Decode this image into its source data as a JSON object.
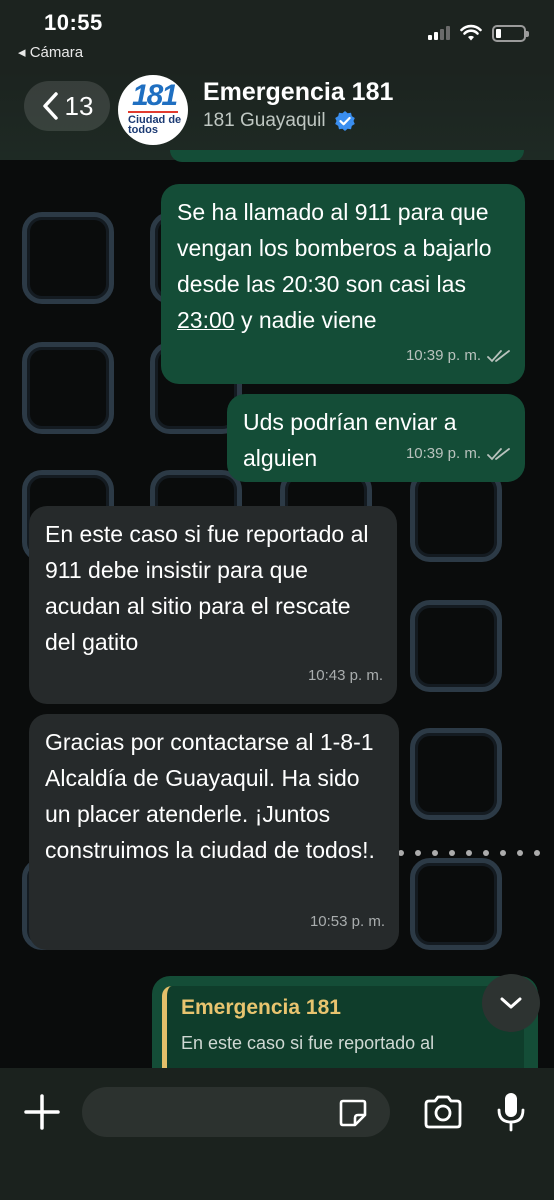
{
  "status_bar": {
    "time": "10:55",
    "back_to_app": "◂ Cámara"
  },
  "header": {
    "back_count": "13",
    "contact_name": "Emergencia 181",
    "contact_subtitle": "181 Guayaquil",
    "avatar_logo_number": "181",
    "avatar_logo_text": "Ciudad de todos"
  },
  "messages": [
    {
      "direction": "out",
      "text_before": "Se ha llamado al 911 para que vengan los bomberos a bajarlo desde las 20:30 son casi las ",
      "text_underlined": "23:00",
      "text_after": " y nadie viene",
      "time": "10:39 p. m."
    },
    {
      "direction": "out",
      "text": "Uds podrían enviar a alguien",
      "time": "10:39 p. m."
    },
    {
      "direction": "in",
      "text": "En este caso si fue reportado al 911 debe insistir para que acudan al sitio para el rescate del gatito",
      "time": "10:43 p. m."
    },
    {
      "direction": "in",
      "text": "Gracias por contactarse al 1-8-1 Alcaldía de Guayaquil. Ha sido un placer atenderle. ¡Juntos construimos la ciudad de todos!.",
      "time": "10:53 p. m."
    }
  ],
  "quoted_reply": {
    "author": "Emergencia 181",
    "text": "En este caso si fue reportado al"
  },
  "colors": {
    "outgoing_bubble": "#144d37",
    "incoming_bubble": "#262a2b",
    "quote_author": "#e8c46f"
  }
}
